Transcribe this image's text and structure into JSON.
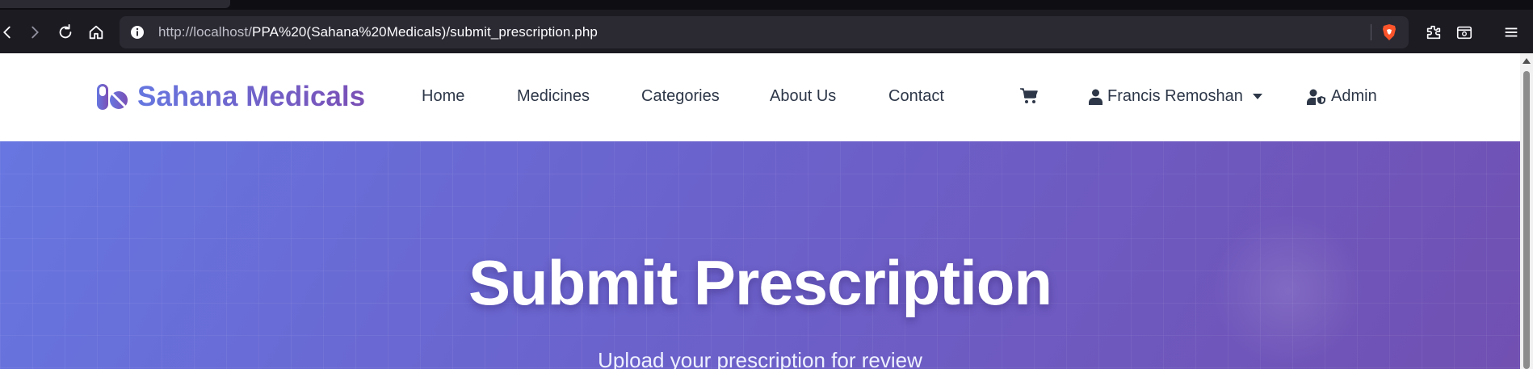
{
  "browser": {
    "url_prefix": "http://localhost/",
    "url_path": "PPA%20(Sahana%20Medicals)/submit_prescription.php"
  },
  "site": {
    "brand": "Sahana Medicals",
    "nav": [
      "Home",
      "Medicines",
      "Categories",
      "About Us",
      "Contact"
    ],
    "user_name": "Francis Remoshan",
    "admin_label": "Admin"
  },
  "hero": {
    "title": "Submit Prescription",
    "subtitle": "Upload your prescription for review"
  },
  "colors": {
    "brand_start": "#6677e0",
    "brand_end": "#7a4fb5",
    "nav_text": "#2d3748",
    "browser_bg": "#1c1b22"
  }
}
